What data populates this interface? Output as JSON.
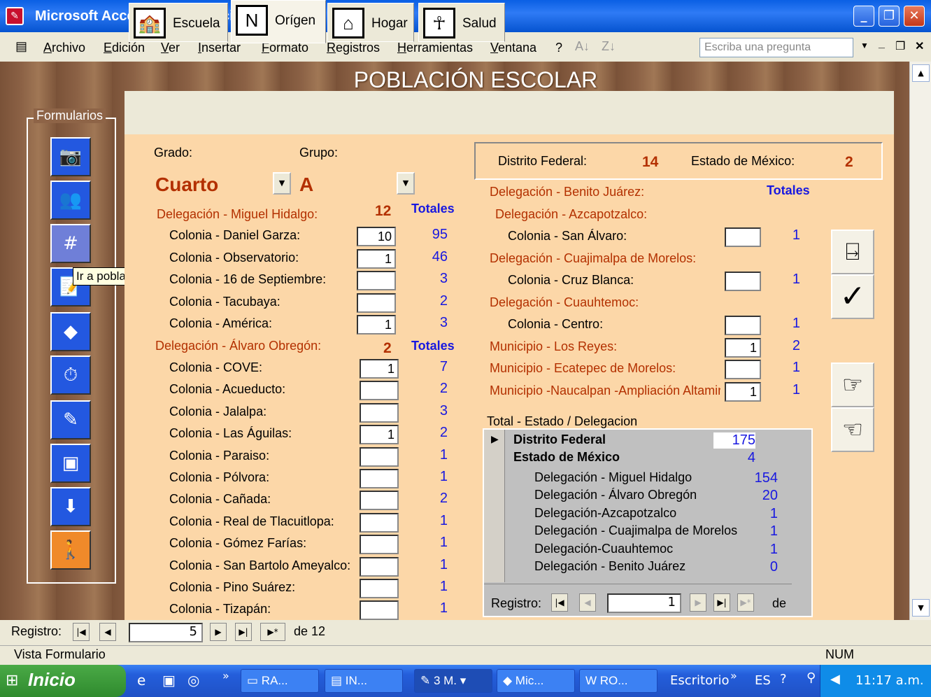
{
  "window": {
    "title": "Microsoft Access - [F_Población alumnos]"
  },
  "menu": {
    "items": [
      "Archivo",
      "Edición",
      "Ver",
      "Insertar",
      "Formato",
      "Registros",
      "Herramientas",
      "Ventana",
      "?"
    ],
    "ask_placeholder": "Escriba una pregunta"
  },
  "form": {
    "title": "POBLACIÓN ESCOLAR",
    "sidebar_label": "Formularios",
    "tooltip": "Ir a población",
    "tabs": [
      "Escuela",
      "Orígen",
      "Hogar",
      "Salud"
    ],
    "grado_label": "Grado:",
    "grupo_label": "Grupo:",
    "grado_value": "Cuarto",
    "grupo_value": "A",
    "left": {
      "deleg1": {
        "label": "Delegación - Miguel Hidalgo:",
        "count": "12",
        "totals_label": "Totales"
      },
      "colonias1": [
        {
          "name": "Colonia - Daniel Garza:",
          "value": "10",
          "total": "95"
        },
        {
          "name": "Colonia - Observatorio:",
          "value": "1",
          "total": "46"
        },
        {
          "name": "Colonia - 16 de Septiembre:",
          "value": "",
          "total": "3"
        },
        {
          "name": "Colonia - Tacubaya:",
          "value": "",
          "total": "2"
        },
        {
          "name": "Colonia - América:",
          "value": "1",
          "total": "3"
        }
      ],
      "deleg2": {
        "label": "Delegación - Álvaro Obregón:",
        "count": "2",
        "totals_label": "Totales"
      },
      "colonias2": [
        {
          "name": "Colonia - COVE:",
          "value": "1",
          "total": "7"
        },
        {
          "name": "Colonia - Acueducto:",
          "value": "",
          "total": "2"
        },
        {
          "name": "Colonia - Jalalpa:",
          "value": "",
          "total": "3"
        },
        {
          "name": "Colonia - Las Águilas:",
          "value": "1",
          "total": "2"
        },
        {
          "name": "Colonia - Paraiso:",
          "value": "",
          "total": "1"
        },
        {
          "name": "Colonia - Pólvora:",
          "value": "",
          "total": "1"
        },
        {
          "name": "Colonia - Cañada:",
          "value": "",
          "total": "2"
        },
        {
          "name": "Colonia - Real de Tlacuitlopa:",
          "value": "",
          "total": "1"
        },
        {
          "name": "Colonia - Gómez Farías:",
          "value": "",
          "total": "1"
        },
        {
          "name": "Colonia - San Bartolo Ameyalco:",
          "value": "",
          "total": "1"
        },
        {
          "name": "Colonia - Pino Suárez:",
          "value": "",
          "total": "1"
        },
        {
          "name": "Colonia - Tizapán:",
          "value": "",
          "total": "1"
        }
      ]
    },
    "right": {
      "df_label": "Distrito Federal:",
      "df_value": "14",
      "edomex_label": "Estado de México:",
      "edomex_value": "2",
      "benito": "Delegación - Benito Juárez:",
      "totals_label": "Totales",
      "azcapotzalco": "Delegación - Azcapotzalco:",
      "rows": [
        {
          "name": "Colonia - San Álvaro:",
          "value": "",
          "total": "1",
          "kind": "colonia"
        },
        {
          "name": "Delegación - Cuajimalpa de Morelos:",
          "kind": "deleg"
        },
        {
          "name": "Colonia - Cruz Blanca:",
          "value": "",
          "total": "1",
          "kind": "colonia"
        },
        {
          "name": "Delegación - Cuauhtemoc:",
          "kind": "deleg"
        },
        {
          "name": "Colonia - Centro:",
          "value": "",
          "total": "1",
          "kind": "colonia"
        },
        {
          "name": "Municipio - Los Reyes:",
          "value": "1",
          "total": "2",
          "kind": "muni"
        },
        {
          "name": "Municipio - Ecatepec de Morelos:",
          "value": "",
          "total": "1",
          "kind": "muni"
        },
        {
          "name": "Municipio -Naucalpan -Ampliación Altamira",
          "value": "1",
          "total": "1",
          "kind": "muni"
        }
      ]
    },
    "subform": {
      "label": "Total - Estado / Delegacion",
      "estados": [
        {
          "name": "Distrito Federal",
          "total": "175"
        },
        {
          "name": "Estado de México",
          "total": "4"
        }
      ],
      "delegaciones": [
        {
          "name": "Delegación - Miguel Hidalgo",
          "total": "154"
        },
        {
          "name": "Delegación - Álvaro Obregón",
          "total": "20"
        },
        {
          "name": "Delegación-Azcapotzalco",
          "total": "1"
        },
        {
          "name": "Delegación - Cuajimalpa de Morelos",
          "total": "1"
        },
        {
          "name": "Delegación-Cuauhtemoc",
          "total": "1"
        },
        {
          "name": "Delegación - Benito Juárez",
          "total": "0"
        }
      ],
      "nav_label": "Registro:",
      "nav_current": "1",
      "nav_of": "de"
    }
  },
  "recordnav": {
    "label": "Registro:",
    "current": "5",
    "of": "de 12"
  },
  "status": {
    "view": "Vista Formulario",
    "num": "NUM"
  },
  "taskbar": {
    "start": "Inicio",
    "items": [
      "RA...",
      "IN...",
      "3 M.",
      "Mic...",
      "RO..."
    ],
    "desktop": "Escritorio",
    "lang": "ES",
    "clock": "11:17 a.m."
  }
}
